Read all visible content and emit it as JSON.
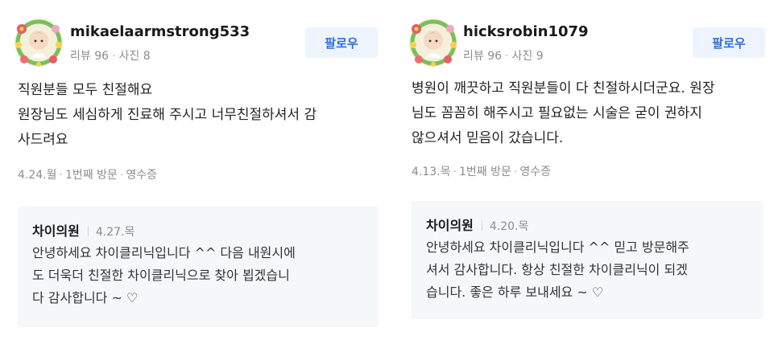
{
  "reviews": [
    {
      "username": "mikaelaarmstrong533",
      "reviews_label": "리뷰 96",
      "photos_label": "사진 8",
      "follow_label": "팔로우",
      "text_lines": [
        "직원분들 모두 친절해요",
        "원장님도 세심하게 진료해 주시고 너무친절하셔서 감",
        "사드려요"
      ],
      "visit_date": "4.24.월",
      "visit_count": "1번째 방문",
      "receipt": "영수증",
      "reply": {
        "name": "차이의원",
        "date": "4.27.목",
        "text_lines": [
          "안녕하세요 차이클리닉입니다 ^^ 다음 내원시에",
          "도 더욱더 친절한 차이클리닉으로 찾아 뵙겠습니",
          "다 감사합니다 ~ ♡"
        ]
      }
    },
    {
      "username": "hicksrobin1079",
      "reviews_label": "리뷰 96",
      "photos_label": "사진 9",
      "follow_label": "팔로우",
      "text_lines": [
        "병원이 깨끗하고 직원분들이 다 친절하시더군요. 원장",
        "님도 꼼꼼히 해주시고 필요없는 시술은 굳이 권하지",
        "않으셔서 믿음이 갔습니다."
      ],
      "visit_date": "4.13.목",
      "visit_count": "1번째 방문",
      "receipt": "영수증",
      "reply": {
        "name": "차이의원",
        "date": "4.20.목",
        "text_lines": [
          "안녕하세요 차이클리닉입니다 ^^ 믿고 방문해주",
          "셔서 감사합니다. 항상 친절한 차이클리닉이 되겠",
          "습니다. 좋은 하루 보내세요 ~ ♡"
        ]
      }
    }
  ]
}
